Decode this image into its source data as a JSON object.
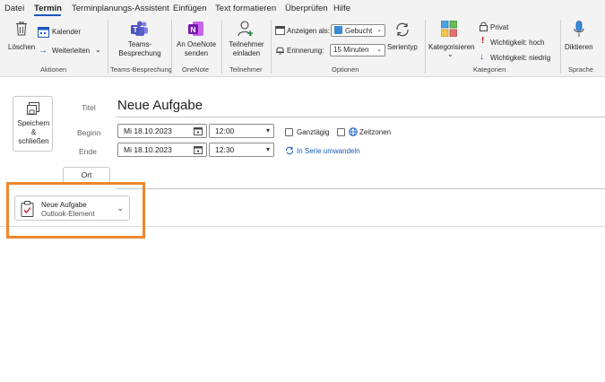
{
  "menu": {
    "items": [
      "Datei",
      "Termin",
      "Terminplanungs-Assistent",
      "Einfügen",
      "Text formatieren",
      "Überprüfen",
      "Hilfe"
    ],
    "active": "Termin"
  },
  "ribbon": {
    "aktionen": {
      "delete": "Löschen",
      "calendar": "Kalender",
      "forward": "Weiterleiten",
      "label": "Aktionen"
    },
    "teams": {
      "button_line1": "Teams-",
      "button_line2": "Besprechung",
      "label": "Teams-Besprechung"
    },
    "onenote": {
      "button_line1": "An OneNote",
      "button_line2": "senden",
      "label": "OneNote"
    },
    "teilnehmer": {
      "button_line1": "Teilnehmer",
      "button_line2": "einladen",
      "label": "Teilnehmer"
    },
    "optionen": {
      "show_as_label": "Anzeigen als:",
      "show_as_value": "Gebucht",
      "reminder_label": "Erinnerung:",
      "reminder_value": "15 Minuten",
      "series": "Serientyp",
      "label": "Optionen"
    },
    "kategorien": {
      "categorize": "Kategorisieren",
      "private": "Privat",
      "high": "Wichtigkeit: hoch",
      "low": "Wichtigkeit: niedrig",
      "label": "Kategorien"
    },
    "sprache": {
      "dictate": "Diktieren",
      "label": "Sprache"
    }
  },
  "form": {
    "save_line1": "Speichern",
    "save_line2": "&",
    "save_line3": "schließen",
    "title_label": "Titel",
    "title_value": "Neue Aufgabe",
    "start_label": "Beginn",
    "start_date": "Mi 18.10.2023",
    "start_time": "12:00",
    "end_label": "Ende",
    "end_date": "Mi 18.10.2023",
    "end_time": "12:30",
    "allday": "Ganztägig",
    "timezones": "Zeitzonen",
    "recurring": "In Serie umwandeln",
    "location_button": "Ort"
  },
  "attachment": {
    "name": "Neue Aufgabe",
    "type": "Outlook-Element"
  },
  "colors": {
    "accent": "#185abd",
    "highlight": "#f0852d",
    "teams": "#5b5fc7",
    "onenote": "#7719aa",
    "importance_high": "#c50f1f"
  }
}
